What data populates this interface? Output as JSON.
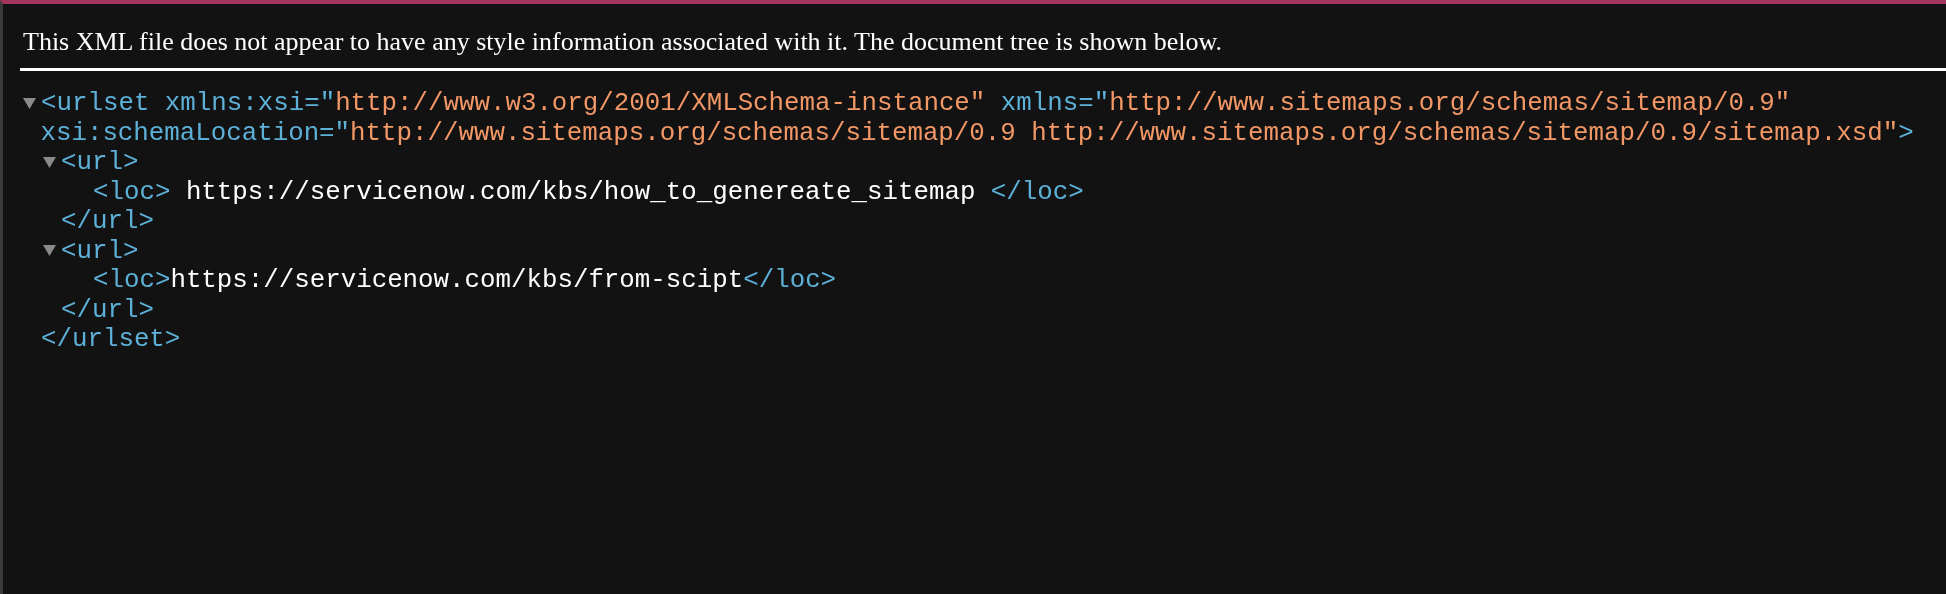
{
  "notice": "This XML file does not appear to have any style information associated with it. The document tree is shown below.",
  "tree": {
    "kind": "element",
    "expanded": true,
    "open_lines": [
      [
        {
          "kind": "tag",
          "text": "<urlset"
        },
        {
          "kind": "attr",
          "text": "xmlns:xsi=\""
        },
        {
          "kind": "value",
          "text": "http://www.w3.org/2001/XMLSchema-instance\""
        },
        {
          "kind": "attr",
          "text": "xmlns=\""
        },
        {
          "kind": "value",
          "text": "http://www.sitemaps.org/schemas/sitemap/0.9\""
        }
      ],
      [
        {
          "kind": "attr",
          "text": "xsi:schemaLocation=\""
        },
        {
          "kind": "value",
          "text": "http://www.sitemaps.org/schemas/sitemap/0.9 http://www.sitemaps.org/schemas/sitemap/0.9/sitemap.xsd\""
        },
        {
          "kind": "tag",
          "text": ">"
        }
      ]
    ],
    "close_tag": "</urlset>",
    "children": [
      {
        "kind": "element",
        "expanded": true,
        "open_lines": [
          [
            {
              "kind": "tag",
              "text": "<url>"
            }
          ]
        ],
        "close_tag": "</url>",
        "children": [
          {
            "kind": "leaf",
            "tokens": [
              {
                "kind": "tag",
                "text": "<loc>"
              },
              {
                "kind": "text",
                "text": "https://servicenow.com/kbs/how_to_genereate_sitemap",
                "padded": true
              },
              {
                "kind": "tag",
                "text": "</loc>"
              }
            ]
          }
        ]
      },
      {
        "kind": "element",
        "expanded": true,
        "open_lines": [
          [
            {
              "kind": "tag",
              "text": "<url>"
            }
          ]
        ],
        "close_tag": "</url>",
        "children": [
          {
            "kind": "leaf",
            "tokens": [
              {
                "kind": "tag",
                "text": "<loc>"
              },
              {
                "kind": "text",
                "text": "https://servicenow.com/kbs/from-scipt",
                "padded": false
              },
              {
                "kind": "tag",
                "text": "</loc>"
              }
            ]
          }
        ]
      }
    ]
  }
}
